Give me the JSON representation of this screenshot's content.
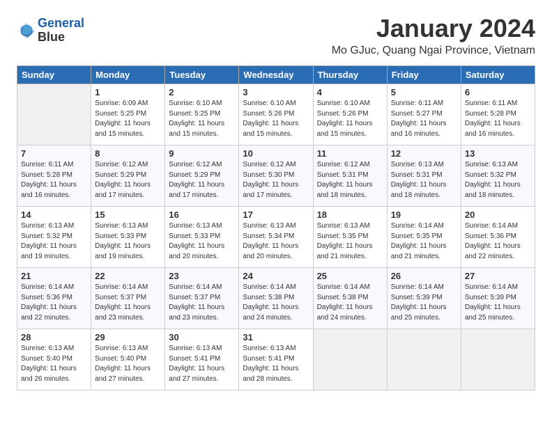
{
  "header": {
    "logo_line1": "General",
    "logo_line2": "Blue",
    "month_title": "January 2024",
    "location": "Mo GJuc, Quang Ngai Province, Vietnam"
  },
  "days_of_week": [
    "Sunday",
    "Monday",
    "Tuesday",
    "Wednesday",
    "Thursday",
    "Friday",
    "Saturday"
  ],
  "weeks": [
    [
      {
        "day": "",
        "info": ""
      },
      {
        "day": "1",
        "info": "Sunrise: 6:09 AM\nSunset: 5:25 PM\nDaylight: 11 hours\nand 15 minutes."
      },
      {
        "day": "2",
        "info": "Sunrise: 6:10 AM\nSunset: 5:25 PM\nDaylight: 11 hours\nand 15 minutes."
      },
      {
        "day": "3",
        "info": "Sunrise: 6:10 AM\nSunset: 5:26 PM\nDaylight: 11 hours\nand 15 minutes."
      },
      {
        "day": "4",
        "info": "Sunrise: 6:10 AM\nSunset: 5:26 PM\nDaylight: 11 hours\nand 15 minutes."
      },
      {
        "day": "5",
        "info": "Sunrise: 6:11 AM\nSunset: 5:27 PM\nDaylight: 11 hours\nand 16 minutes."
      },
      {
        "day": "6",
        "info": "Sunrise: 6:11 AM\nSunset: 5:28 PM\nDaylight: 11 hours\nand 16 minutes."
      }
    ],
    [
      {
        "day": "7",
        "info": "Sunrise: 6:11 AM\nSunset: 5:28 PM\nDaylight: 11 hours\nand 16 minutes."
      },
      {
        "day": "8",
        "info": "Sunrise: 6:12 AM\nSunset: 5:29 PM\nDaylight: 11 hours\nand 17 minutes."
      },
      {
        "day": "9",
        "info": "Sunrise: 6:12 AM\nSunset: 5:29 PM\nDaylight: 11 hours\nand 17 minutes."
      },
      {
        "day": "10",
        "info": "Sunrise: 6:12 AM\nSunset: 5:30 PM\nDaylight: 11 hours\nand 17 minutes."
      },
      {
        "day": "11",
        "info": "Sunrise: 6:12 AM\nSunset: 5:31 PM\nDaylight: 11 hours\nand 18 minutes."
      },
      {
        "day": "12",
        "info": "Sunrise: 6:13 AM\nSunset: 5:31 PM\nDaylight: 11 hours\nand 18 minutes."
      },
      {
        "day": "13",
        "info": "Sunrise: 6:13 AM\nSunset: 5:32 PM\nDaylight: 11 hours\nand 18 minutes."
      }
    ],
    [
      {
        "day": "14",
        "info": "Sunrise: 6:13 AM\nSunset: 5:32 PM\nDaylight: 11 hours\nand 19 minutes."
      },
      {
        "day": "15",
        "info": "Sunrise: 6:13 AM\nSunset: 5:33 PM\nDaylight: 11 hours\nand 19 minutes."
      },
      {
        "day": "16",
        "info": "Sunrise: 6:13 AM\nSunset: 5:33 PM\nDaylight: 11 hours\nand 20 minutes."
      },
      {
        "day": "17",
        "info": "Sunrise: 6:13 AM\nSunset: 5:34 PM\nDaylight: 11 hours\nand 20 minutes."
      },
      {
        "day": "18",
        "info": "Sunrise: 6:13 AM\nSunset: 5:35 PM\nDaylight: 11 hours\nand 21 minutes."
      },
      {
        "day": "19",
        "info": "Sunrise: 6:14 AM\nSunset: 5:35 PM\nDaylight: 11 hours\nand 21 minutes."
      },
      {
        "day": "20",
        "info": "Sunrise: 6:14 AM\nSunset: 5:36 PM\nDaylight: 11 hours\nand 22 minutes."
      }
    ],
    [
      {
        "day": "21",
        "info": "Sunrise: 6:14 AM\nSunset: 5:36 PM\nDaylight: 11 hours\nand 22 minutes."
      },
      {
        "day": "22",
        "info": "Sunrise: 6:14 AM\nSunset: 5:37 PM\nDaylight: 11 hours\nand 23 minutes."
      },
      {
        "day": "23",
        "info": "Sunrise: 6:14 AM\nSunset: 5:37 PM\nDaylight: 11 hours\nand 23 minutes."
      },
      {
        "day": "24",
        "info": "Sunrise: 6:14 AM\nSunset: 5:38 PM\nDaylight: 11 hours\nand 24 minutes."
      },
      {
        "day": "25",
        "info": "Sunrise: 6:14 AM\nSunset: 5:38 PM\nDaylight: 11 hours\nand 24 minutes."
      },
      {
        "day": "26",
        "info": "Sunrise: 6:14 AM\nSunset: 5:39 PM\nDaylight: 11 hours\nand 25 minutes."
      },
      {
        "day": "27",
        "info": "Sunrise: 6:14 AM\nSunset: 5:39 PM\nDaylight: 11 hours\nand 25 minutes."
      }
    ],
    [
      {
        "day": "28",
        "info": "Sunrise: 6:13 AM\nSunset: 5:40 PM\nDaylight: 11 hours\nand 26 minutes."
      },
      {
        "day": "29",
        "info": "Sunrise: 6:13 AM\nSunset: 5:40 PM\nDaylight: 11 hours\nand 27 minutes."
      },
      {
        "day": "30",
        "info": "Sunrise: 6:13 AM\nSunset: 5:41 PM\nDaylight: 11 hours\nand 27 minutes."
      },
      {
        "day": "31",
        "info": "Sunrise: 6:13 AM\nSunset: 5:41 PM\nDaylight: 11 hours\nand 28 minutes."
      },
      {
        "day": "",
        "info": ""
      },
      {
        "day": "",
        "info": ""
      },
      {
        "day": "",
        "info": ""
      }
    ]
  ]
}
